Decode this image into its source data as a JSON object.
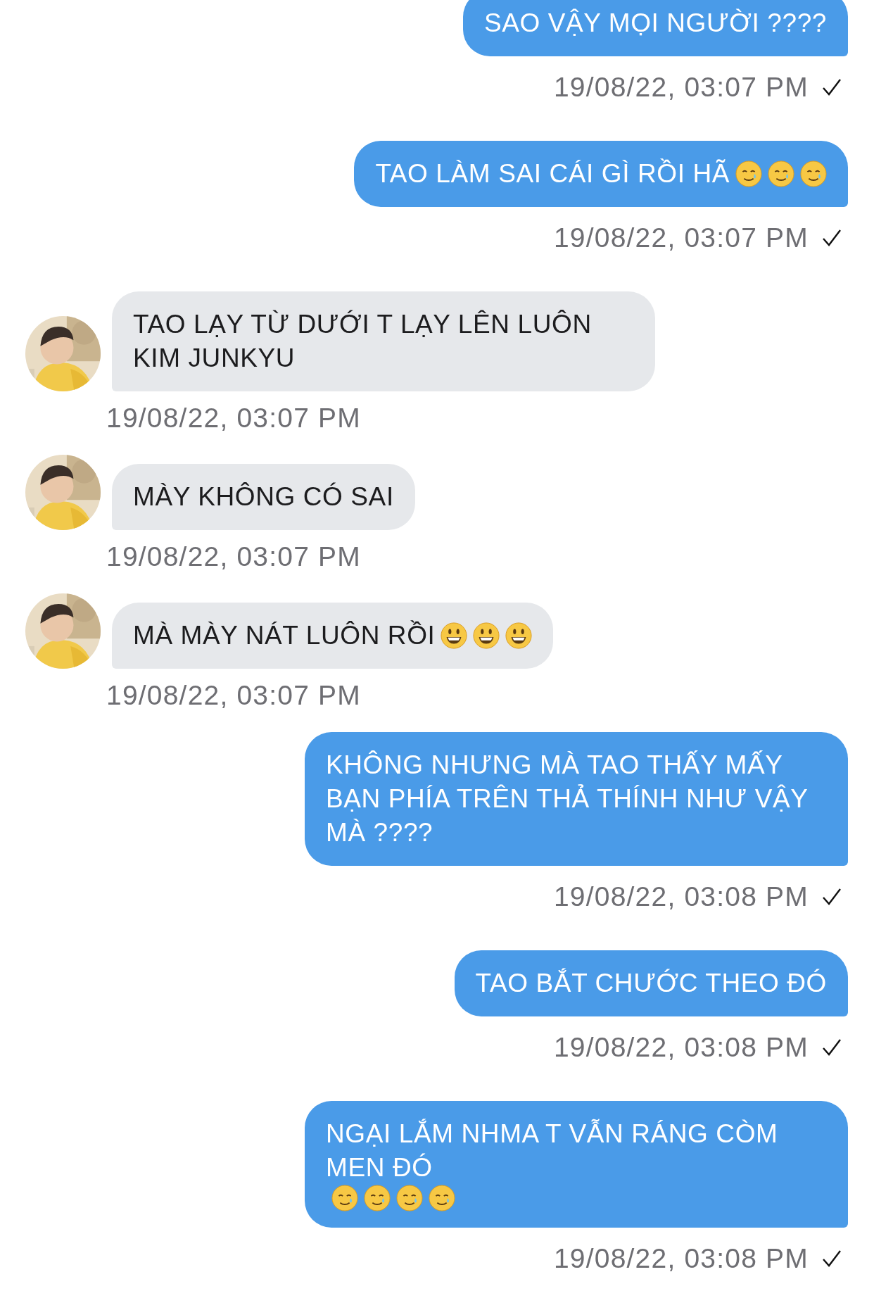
{
  "messages": [
    {
      "kind": "sent",
      "text": "SAO VẬY MỌI NGƯỜI ????",
      "time": "19/08/22, 03:07 PM",
      "read": true
    },
    {
      "kind": "sent",
      "text": "TAO LÀM SAI CÁI GÌ RỒI HÃ",
      "emojis": [
        {
          "kind": "smiling-tear"
        },
        {
          "kind": "smiling-tear"
        },
        {
          "kind": "smiling-tear"
        }
      ],
      "time": "19/08/22, 03:07 PM",
      "read": true
    },
    {
      "kind": "received",
      "text": "TAO LẠY TỪ DƯỚI T LẠY LÊN LUÔN KIM JUNKYU",
      "time": "19/08/22, 03:07 PM"
    },
    {
      "kind": "received",
      "text": "MÀY KHÔNG CÓ SAI",
      "time": "19/08/22, 03:07 PM"
    },
    {
      "kind": "received",
      "text": "MÀ MÀY NÁT LUÔN RỒI",
      "emojis": [
        {
          "kind": "grinning"
        },
        {
          "kind": "grinning"
        },
        {
          "kind": "grinning"
        }
      ],
      "time": "19/08/22, 03:07 PM"
    },
    {
      "kind": "sent",
      "text": "KHÔNG NHƯNG MÀ TAO THẤY MẤY BẠN PHÍA TRÊN THẢ THÍNH NHƯ VẬY MÀ ????",
      "time": "19/08/22, 03:08 PM",
      "read": true
    },
    {
      "kind": "sent",
      "text": "TAO BẮT CHƯỚC THEO ĐÓ",
      "time": "19/08/22, 03:08 PM",
      "read": true
    },
    {
      "kind": "sent",
      "text": "NGẠI LẮM NHMA T VẪN RÁNG CÒM MEN ĐÓ",
      "emojis": [
        {
          "kind": "smiling-tear"
        },
        {
          "kind": "smiling-tear"
        },
        {
          "kind": "smiling-tear"
        },
        {
          "kind": "smiling-tear"
        }
      ],
      "time": "19/08/22, 03:08 PM",
      "read": true
    }
  ]
}
